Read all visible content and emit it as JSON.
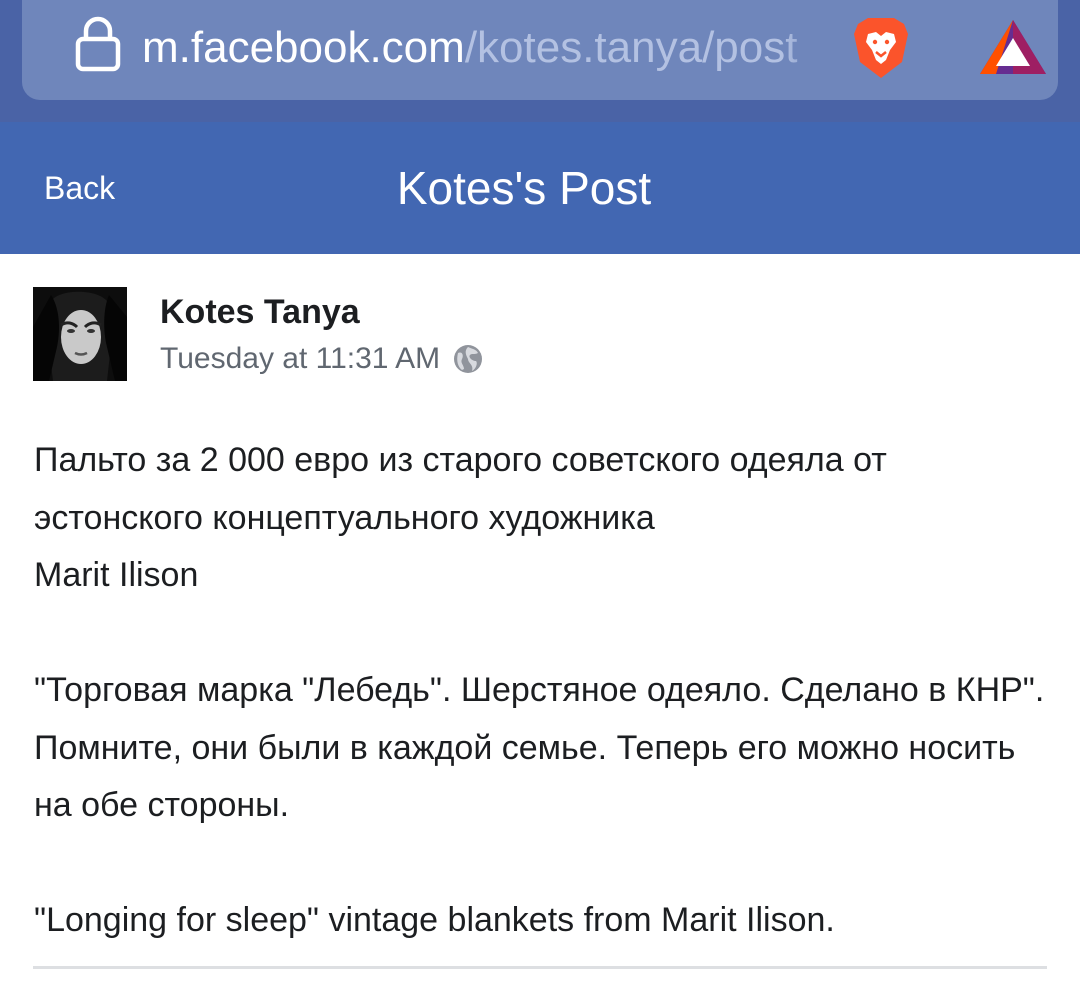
{
  "browser": {
    "url_host": "m.facebook.com",
    "url_path": "/kotes.tanya/post",
    "icons": [
      "lock-icon",
      "brave-lion-icon",
      "bat-rewards-icon"
    ],
    "colors": {
      "bar": "#4a63a6",
      "pill": "#6f86bb"
    }
  },
  "header": {
    "back_label": "Back",
    "title": "Kotes's Post",
    "color": "#4267b2"
  },
  "post": {
    "author": "Kotes Tanya",
    "timestamp": "Tuesday at 11:31 AM",
    "privacy_icon": "globe-icon",
    "paragraphs": [
      "Пальто за 2 000 евро из старого советского одеяла от эстонского концептуального художника",
      "Marit Ilison",
      "\"Торговая марка \"Лебедь\". Шерстяное одеяло. Сделано в КНР\". Помните, они были в каждой семье. Теперь его можно носить на обе стороны.",
      "\"Longing for sleep\" vintage blankets from Marit Ilison."
    ]
  }
}
